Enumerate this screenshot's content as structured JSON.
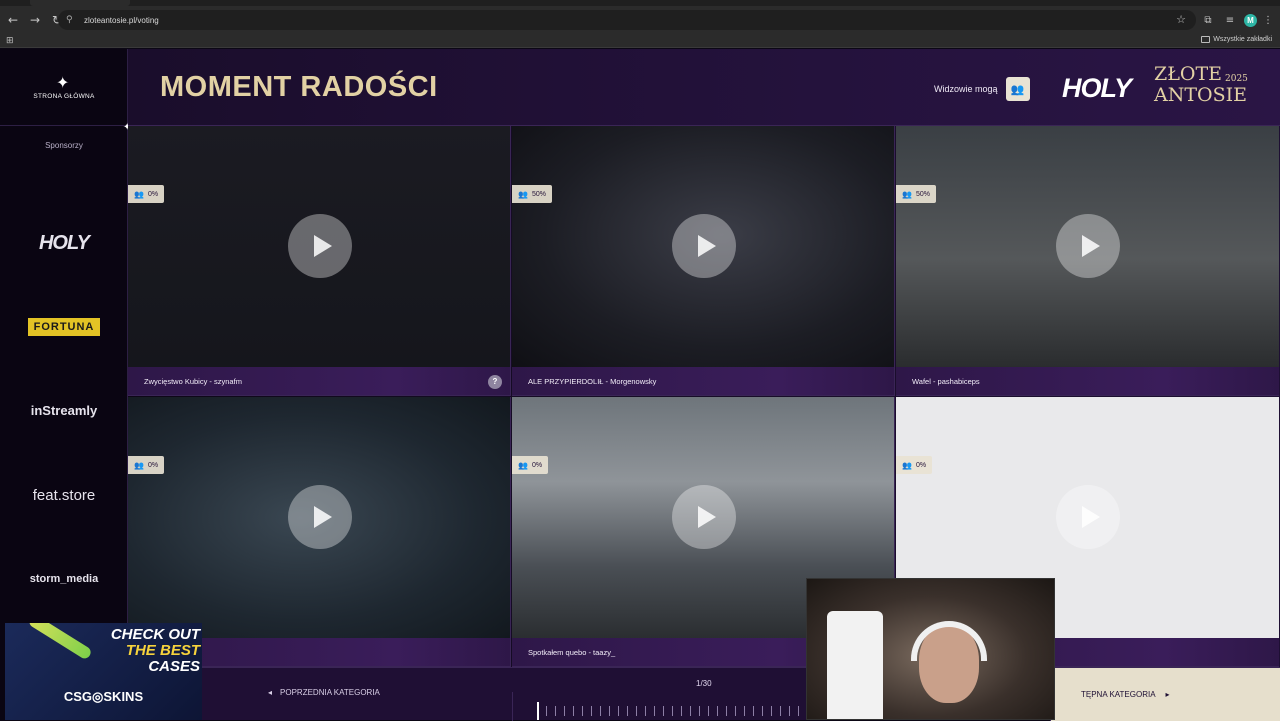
{
  "browser": {
    "url": "zloteantosie.pl/voting",
    "bookmarks_all_label": "Wszystkie zakładki",
    "profile_initial": "M"
  },
  "nav": {
    "home_label": "STRONA GŁÓWNA",
    "sponsors_label": "Sponsorzy",
    "sponsors": [
      "HOLY",
      "FORTUNA",
      "inStreamly",
      "feat.store",
      "storm_media"
    ]
  },
  "header": {
    "title": "MOMENT RADOŚCI",
    "viewers_label": "Widzowie mogą",
    "brand_holy": "HOLY",
    "brand_zlote_line1": "ZŁOTE",
    "brand_zlote_line2": "ANTOSIE",
    "brand_year": "2025"
  },
  "tiles": [
    {
      "caption": "Zwycięstwo Kubicy - szynafm",
      "percent": "0%"
    },
    {
      "caption": "ALE PRZYPIERDOLIŁ - Morgenowsky",
      "percent": "50%"
    },
    {
      "caption": "Wafel - pashabiceps",
      "percent": "50%"
    },
    {
      "caption": "",
      "percent": "0%"
    },
    {
      "caption": "Spotkałem quebo - taazy_",
      "percent": "0%"
    },
    {
      "caption": "",
      "percent": "0%"
    }
  ],
  "footer": {
    "prev_label": "POPRZEDNIA KATEGORIA",
    "next_label": "TĘPNA KATEGORIA",
    "counter": "1/30"
  },
  "ad": {
    "line1": "CHECK OUT",
    "line2": "THE BEST",
    "line3": "CASES",
    "brand": "CSG◎SKINS"
  },
  "colors": {
    "accent_gold": "#e2d1a4",
    "bg_dark": "#0a0512",
    "caption_bar": "#3a1d5a",
    "fortuna_yellow": "#e3c325"
  }
}
